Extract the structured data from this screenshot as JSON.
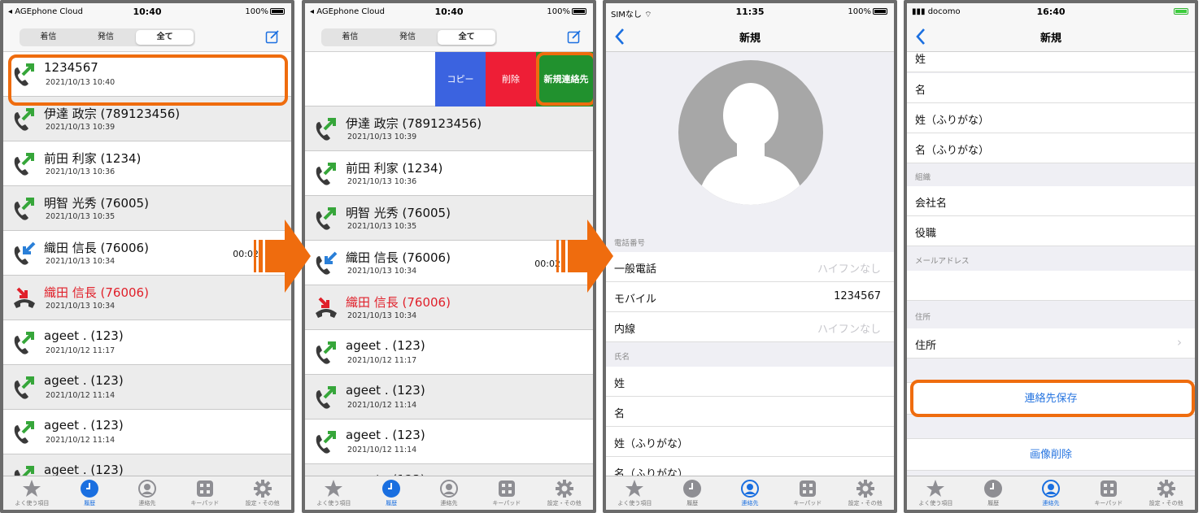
{
  "screen1": {
    "status": {
      "carrier": "◂ AGEphone Cloud",
      "time": "10:40",
      "battery": "100%"
    },
    "segments": [
      "着信",
      "発信",
      "全て"
    ],
    "calls": [
      {
        "name": "1234567",
        "date": "2021/10/13 10:40",
        "kind": "outgoing"
      },
      {
        "name": "伊達 政宗 (789123456)",
        "date": "2021/10/13 10:39",
        "kind": "outgoing"
      },
      {
        "name": "前田 利家 (1234)",
        "date": "2021/10/13 10:36",
        "kind": "outgoing"
      },
      {
        "name": "明智 光秀 (76005)",
        "date": "2021/10/13 10:35",
        "kind": "outgoing"
      },
      {
        "name": "織田 信長 (76006)",
        "date": "2021/10/13 10:34",
        "kind": "incoming",
        "duration": "00:02"
      },
      {
        "name": "織田 信長 (76006)",
        "date": "2021/10/13 10:34",
        "kind": "missed"
      },
      {
        "name": "ageet . (123)",
        "date": "2021/10/12 11:17",
        "kind": "outgoing"
      },
      {
        "name": "ageet . (123)",
        "date": "2021/10/12 11:14",
        "kind": "outgoing"
      },
      {
        "name": "ageet . (123)",
        "date": "2021/10/12 11:14",
        "kind": "outgoing"
      },
      {
        "name": "ageet . (123)",
        "date": "",
        "kind": "outgoing"
      }
    ]
  },
  "screen2": {
    "status": {
      "carrier": "◂ AGEphone Cloud",
      "time": "10:40",
      "battery": "100%"
    },
    "segments": [
      "着信",
      "発信",
      "全て"
    ],
    "actions": {
      "copy": "コピー",
      "delete": "削除",
      "new_contact": "新規連絡先"
    }
  },
  "screen3": {
    "status": {
      "carrier": "SIMなし",
      "time": "11:35",
      "battery": "100%"
    },
    "title": "新規",
    "phone_section": "電話番号",
    "phone_rows": [
      {
        "label": "一般電話",
        "value": "",
        "placeholder": "ハイフンなし"
      },
      {
        "label": "モバイル",
        "value": "1234567",
        "placeholder": ""
      },
      {
        "label": "内線",
        "value": "",
        "placeholder": "ハイフンなし"
      }
    ],
    "name_section": "氏名",
    "name_rows": [
      "姓",
      "名",
      "姓（ふりがな）",
      "名（ふりがな）"
    ]
  },
  "screen4": {
    "status": {
      "carrier": "docomo",
      "time": "16:40",
      "battery": ""
    },
    "title": "新規",
    "name_rows": [
      "姓",
      "名",
      "姓（ふりがな）",
      "名（ふりがな）"
    ],
    "org_section": "組織",
    "org_rows": [
      "会社名",
      "役職"
    ],
    "mail_section": "メールアドレス",
    "addr_section": "住所",
    "addr_row": "住所",
    "save_button": "連絡先保存",
    "delete_image_button": "画像削除"
  },
  "tabbar": [
    "よく使う項目",
    "履歴",
    "連絡先",
    "キーパッド",
    "設定・その他"
  ],
  "colors": {
    "highlight": "#ef6c0e",
    "accent": "#1a6fe0",
    "missed": "#e0202a",
    "copy": "#3b63e0",
    "delete": "#ee1e36",
    "new": "#21912e"
  }
}
